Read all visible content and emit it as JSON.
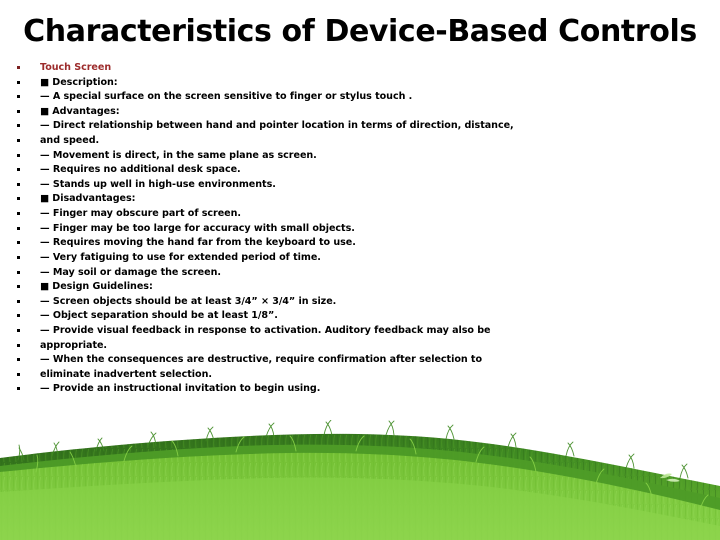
{
  "slide": {
    "title": "Characteristics of Device-Based Controls",
    "background_color": "#ffffff",
    "accent_color": "#9c2b2b",
    "text_color": "#000000"
  },
  "bullets": [
    {
      "text": "Touch Screen",
      "accent": true
    },
    {
      "text": "■ Description:",
      "accent": false
    },
    {
      "text": "— A special surface on the screen sensitive to finger or stylus touch .",
      "accent": false
    },
    {
      "text": "■ Advantages:",
      "accent": false
    },
    {
      "text": "— Direct relationship between hand and pointer location in terms of direction, distance,",
      "accent": false
    },
    {
      "text": "and speed.",
      "accent": false
    },
    {
      "text": "— Movement is direct, in the same plane as screen.",
      "accent": false
    },
    {
      "text": "— Requires no additional desk space.",
      "accent": false
    },
    {
      "text": "— Stands up well in high-use environments.",
      "accent": false
    },
    {
      "text": "■ Disadvantages:",
      "accent": false
    },
    {
      "text": "— Finger may obscure part of screen.",
      "accent": false
    },
    {
      "text": "— Finger may be too large for accuracy with small objects.",
      "accent": false
    },
    {
      "text": "— Requires moving the hand far from the keyboard to use.",
      "accent": false
    },
    {
      "text": "— Very fatiguing to use for extended period of time.",
      "accent": false
    },
    {
      "text": "— May soil or damage the screen.",
      "accent": false
    },
    {
      "text": "■ Design Guidelines:",
      "accent": false
    },
    {
      "text": "— Screen objects should be at least 3/4” × 3/4” in size.",
      "accent": false
    },
    {
      "text": "— Object separation should be at least 1/8”.",
      "accent": false
    },
    {
      "text": "— Provide visual feedback in response to activation. Auditory feedback may also be",
      "accent": false
    },
    {
      "text": "appropriate.",
      "accent": false
    },
    {
      "text": "— When the consequences are destructive, require confirmation after selection to",
      "accent": false
    },
    {
      "text": "eliminate inadvertent selection.",
      "accent": false
    },
    {
      "text": "— Provide an instructional invitation to begin using.",
      "accent": false
    }
  ],
  "artwork": {
    "name": "grass-field",
    "colors": {
      "light_green": "#7ec93f",
      "mid_green": "#63b32e",
      "dark_green": "#3f8a22",
      "deep_green": "#2f6b1a"
    }
  }
}
